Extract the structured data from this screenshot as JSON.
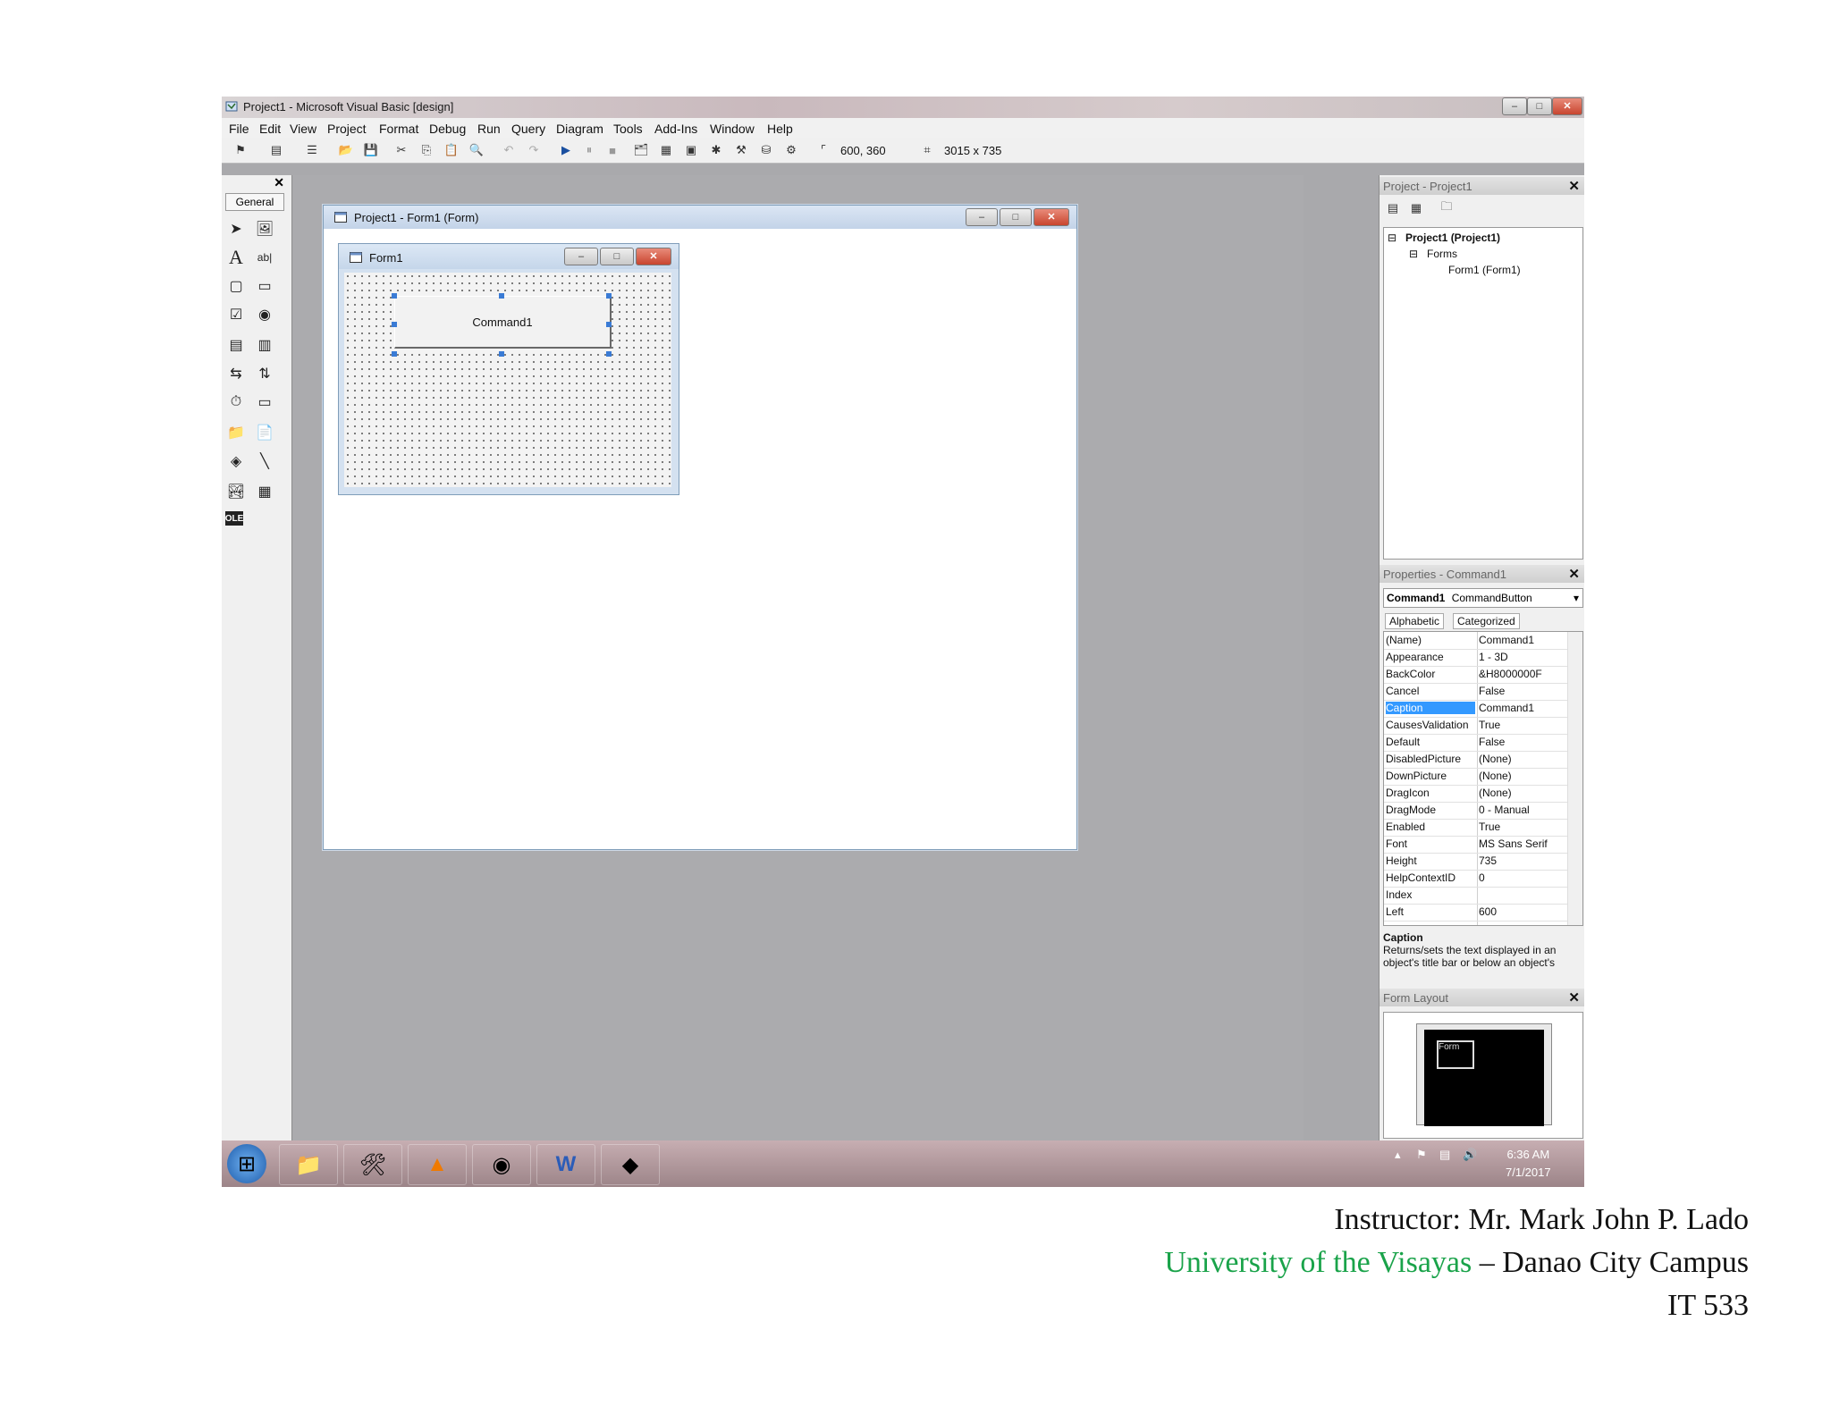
{
  "window": {
    "title": "Project1 - Microsoft Visual Basic [design]",
    "min": "–",
    "max": "□",
    "close": "✕"
  },
  "menu": [
    "File",
    "Edit",
    "View",
    "Project",
    "Format",
    "Debug",
    "Run",
    "Query",
    "Diagram",
    "Tools",
    "Add-Ins",
    "Window",
    "Help"
  ],
  "toolbar": {
    "position": "600, 360",
    "size": "3015 x 735"
  },
  "toolbox": {
    "tab": "General",
    "close": "✕"
  },
  "designer": {
    "title": "Project1 - Form1 (Form)"
  },
  "form": {
    "title": "Form1",
    "button": "Command1"
  },
  "project_explorer": {
    "title": "Project - Project1",
    "close": "✕",
    "project": "Project1 (Project1)",
    "folder": "Forms",
    "item": "Form1 (Form1)"
  },
  "properties": {
    "title": "Properties - Command1",
    "close": "✕",
    "object": "Command1",
    "object_type": "CommandButton",
    "tabs": [
      "Alphabetic",
      "Categorized"
    ],
    "rows": [
      {
        "k": "(Name)",
        "v": "Command1"
      },
      {
        "k": "Appearance",
        "v": "1 - 3D"
      },
      {
        "k": "BackColor",
        "v": "&H8000000F"
      },
      {
        "k": "Cancel",
        "v": "False"
      },
      {
        "k": "Caption",
        "v": "Command1"
      },
      {
        "k": "CausesValidation",
        "v": "True"
      },
      {
        "k": "Default",
        "v": "False"
      },
      {
        "k": "DisabledPicture",
        "v": "(None)"
      },
      {
        "k": "DownPicture",
        "v": "(None)"
      },
      {
        "k": "DragIcon",
        "v": "(None)"
      },
      {
        "k": "DragMode",
        "v": "0 - Manual"
      },
      {
        "k": "Enabled",
        "v": "True"
      },
      {
        "k": "Font",
        "v": "MS Sans Serif"
      },
      {
        "k": "Height",
        "v": "735"
      },
      {
        "k": "HelpContextID",
        "v": "0"
      },
      {
        "k": "Index",
        "v": ""
      },
      {
        "k": "Left",
        "v": "600"
      }
    ],
    "desc_title": "Caption",
    "desc_text": "Returns/sets the text displayed in an object's title bar or below an object's"
  },
  "form_layout": {
    "title": "Form Layout",
    "close": "✕",
    "mini": "Form"
  },
  "taskbar": {
    "time": "6:36 AM",
    "date": "7/1/2017"
  },
  "footer": {
    "instructor": "Instructor: Mr. Mark John P. Lado",
    "university": "University of the Visayas",
    "campus": " – Danao City Campus",
    "course": "IT 533"
  }
}
